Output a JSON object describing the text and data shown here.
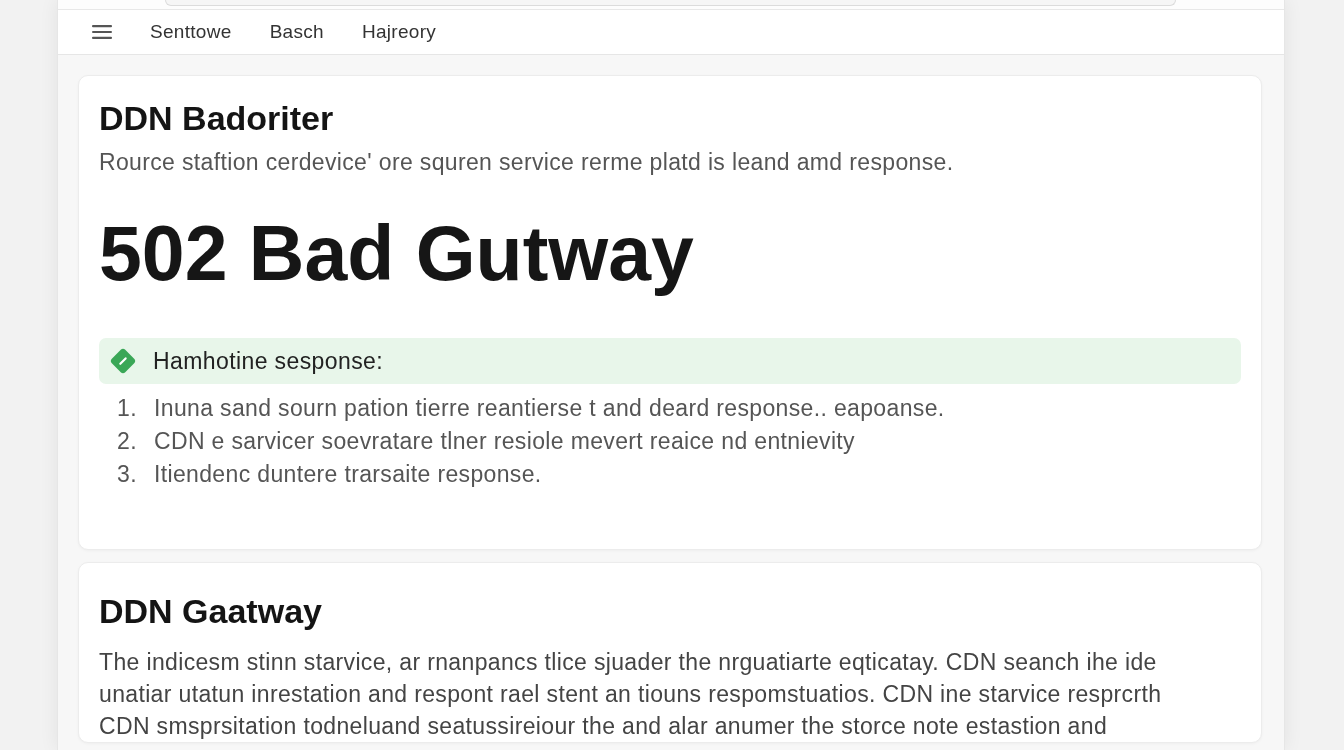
{
  "nav": {
    "items": [
      "Senttowe",
      "Basch",
      "Hajreory"
    ]
  },
  "error_card": {
    "title": "DDN Badoriter",
    "subtitle": "Rource staftion cerdevice' ore squren service rerme platd is leand amd response.",
    "status": "502 Bad Gutway",
    "callout": "Hamhotine sesponse:",
    "steps": [
      {
        "number": "1.",
        "text": "Inuna sand sourn pation tierre reantierse t and deard response.. eapoanse."
      },
      {
        "number": "2.",
        "text": "CDN e sarvicer soevratare tlner resiole mevert reaice nd entnievity"
      },
      {
        "number": "3.",
        "text": "Itiendenc duntere trarsaite response."
      }
    ]
  },
  "info_card": {
    "title": "DDN Gaatway",
    "paragraph": "The indicesm stinn starvice, ar rnanpancs tlice sjuader the nrguatiarte eqticatay. CDN seanch ihe ide unatiar utatun inrestation and respont rael stent an tiouns respomstuatios. CDN ine starvice resprcrth CDN smsprsitation todneluand seatussireiour the and alar anumer the storce note estastion and"
  }
}
